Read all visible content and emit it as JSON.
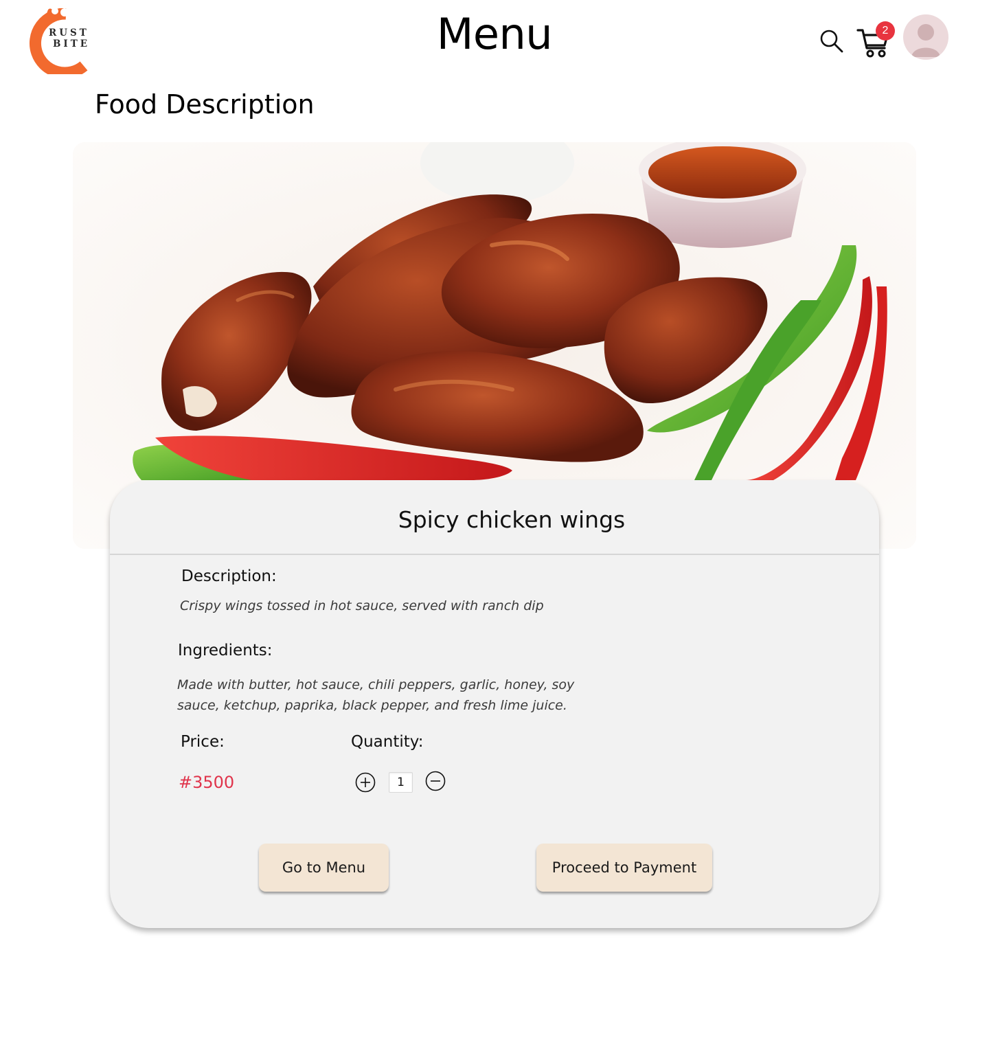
{
  "brand": {
    "logo_text_line1": "RUST",
    "logo_text_line2": "BITE",
    "accent_color": "#f26a2e"
  },
  "header": {
    "title": "Menu",
    "cart_count": "2",
    "icons": [
      "search-icon",
      "cart-icon",
      "user-avatar-icon"
    ]
  },
  "page": {
    "section_heading": "Food Description"
  },
  "food": {
    "name": "Spicy chicken wings",
    "description_label": "Description:",
    "description": "Crispy wings tossed in hot sauce, served with ranch dip",
    "ingredients_label": "Ingredients:",
    "ingredients_line1": "Made with butter, hot sauce, chili peppers, garlic, honey, soy",
    "ingredients_line2": "sauce, ketchup, paprika, black pepper, and fresh lime juice.",
    "price_label": "Price:",
    "price": "#3500",
    "quantity_label": "Quantity:",
    "quantity": "1"
  },
  "actions": {
    "go_to_menu": "Go to Menu",
    "proceed_to_payment": "Proceed to Payment"
  },
  "colors": {
    "price": "#e0344b",
    "badge": "#e8343f",
    "button_bg": "#f3e5d4",
    "card_bg": "#f2f2f2"
  }
}
